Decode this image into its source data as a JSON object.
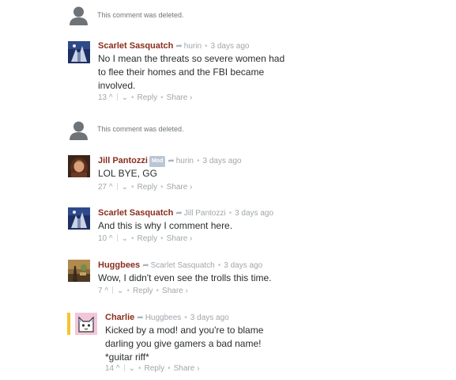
{
  "deleted_text": "This comment was deleted.",
  "labels": {
    "reply": "Reply",
    "share": "Share ›",
    "mod": "Mod",
    "up": "^",
    "down": "⌄",
    "bullet": "•"
  },
  "colors": {
    "name": "#8a2d1d",
    "meta": "#a1a6aa",
    "highlight": "#f4c430"
  },
  "comments": [
    {
      "author": "Scarlet Sasquatch",
      "reply_to": "hurin",
      "time": "3 days ago",
      "lines": [
        "No I mean the threats so severe women had",
        "to flee their homes and the FBI became",
        "involved."
      ],
      "votes": "13"
    },
    {
      "author": "Jill Pantozzi",
      "reply_to": "hurin",
      "time": "3 days ago",
      "lines": [
        "LOL BYE, GG"
      ],
      "votes": "27"
    },
    {
      "author": "Scarlet Sasquatch",
      "reply_to": "Jill Pantozzi",
      "time": "3 days ago",
      "lines": [
        "And this is why I comment here."
      ],
      "votes": "10"
    },
    {
      "author": "Huggbees",
      "reply_to": "Scarlet Sasquatch",
      "time": "3 days ago",
      "lines": [
        "Wow, I didn't even see the trolls this time."
      ],
      "votes": "7"
    },
    {
      "author": "Charlie",
      "reply_to": "Huggbees",
      "time": "3 days ago",
      "lines": [
        "Kicked by a mod! and you're to blame",
        "darling you give gamers a bad name!",
        "*guitar riff*"
      ],
      "votes": "14"
    }
  ]
}
